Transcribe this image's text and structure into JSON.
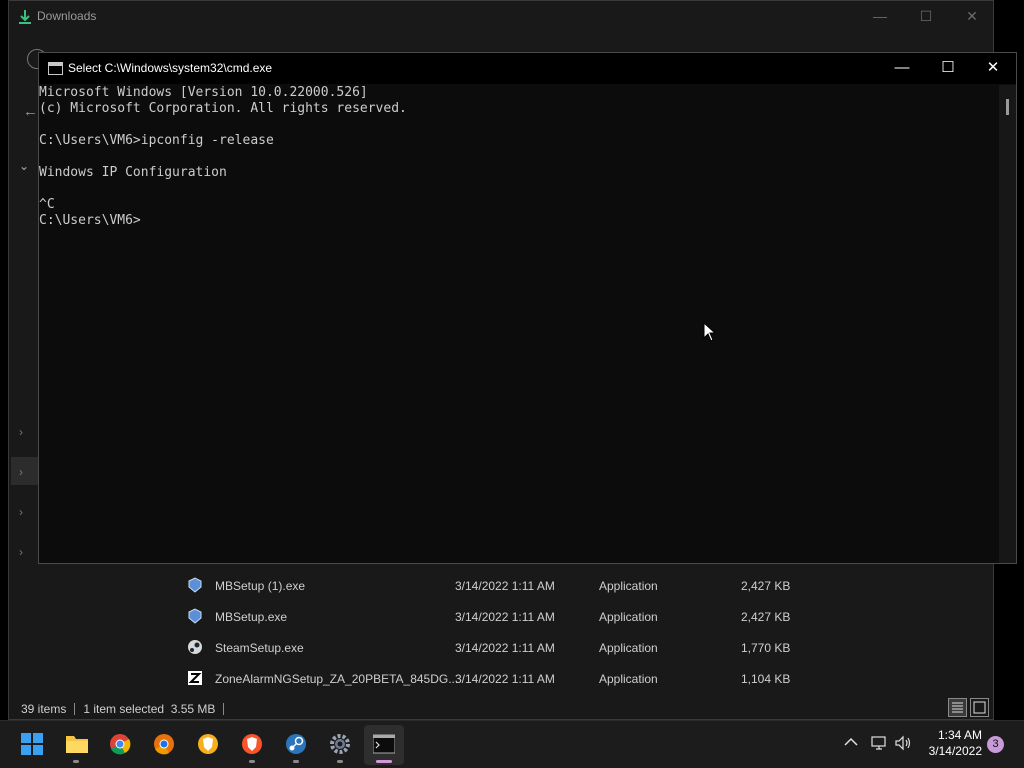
{
  "explorer": {
    "title": "Downloads",
    "controls": {
      "minimize": "—",
      "maximize": "☐",
      "close": "✕"
    },
    "files": [
      {
        "name": "MBSetup (1).exe",
        "date": "3/14/2022 1:11 AM",
        "type": "Application",
        "size": "2,427 KB"
      },
      {
        "name": "MBSetup.exe",
        "date": "3/14/2022 1:11 AM",
        "type": "Application",
        "size": "2,427 KB"
      },
      {
        "name": "SteamSetup.exe",
        "date": "3/14/2022 1:11 AM",
        "type": "Application",
        "size": "1,770 KB"
      },
      {
        "name": "ZoneAlarmNGSetup_ZA_20PBETA_845DG...",
        "date": "3/14/2022 1:11 AM",
        "type": "Application",
        "size": "1,104 KB"
      }
    ],
    "status": {
      "count": "39 items",
      "selected": "1 item selected  3.55 MB"
    }
  },
  "cmd": {
    "title": "Select C:\\Windows\\system32\\cmd.exe",
    "controls": {
      "minimize": "—",
      "maximize": "☐",
      "close": "✕"
    },
    "lines": [
      "Microsoft Windows [Version 10.0.22000.526]",
      "(c) Microsoft Corporation. All rights reserved.",
      "",
      "C:\\Users\\VM6>ipconfig -release",
      "",
      "Windows IP Configuration",
      "",
      "^C",
      "C:\\Users\\VM6>"
    ]
  },
  "taskbar": {
    "apps": [
      "start-icon",
      "file-explorer-icon",
      "chrome-icon",
      "chrome-beta-icon",
      "brave-icon",
      "brave-beta-icon",
      "steam-icon",
      "settings-icon",
      "terminal-icon"
    ],
    "time": "1:34 AM",
    "date": "3/14/2022",
    "notifications": "3",
    "tray_chevron": "^"
  },
  "colors": {
    "accent": "#0078d4",
    "terminal_text": "#cccccc",
    "notification": "#c89ad8"
  }
}
